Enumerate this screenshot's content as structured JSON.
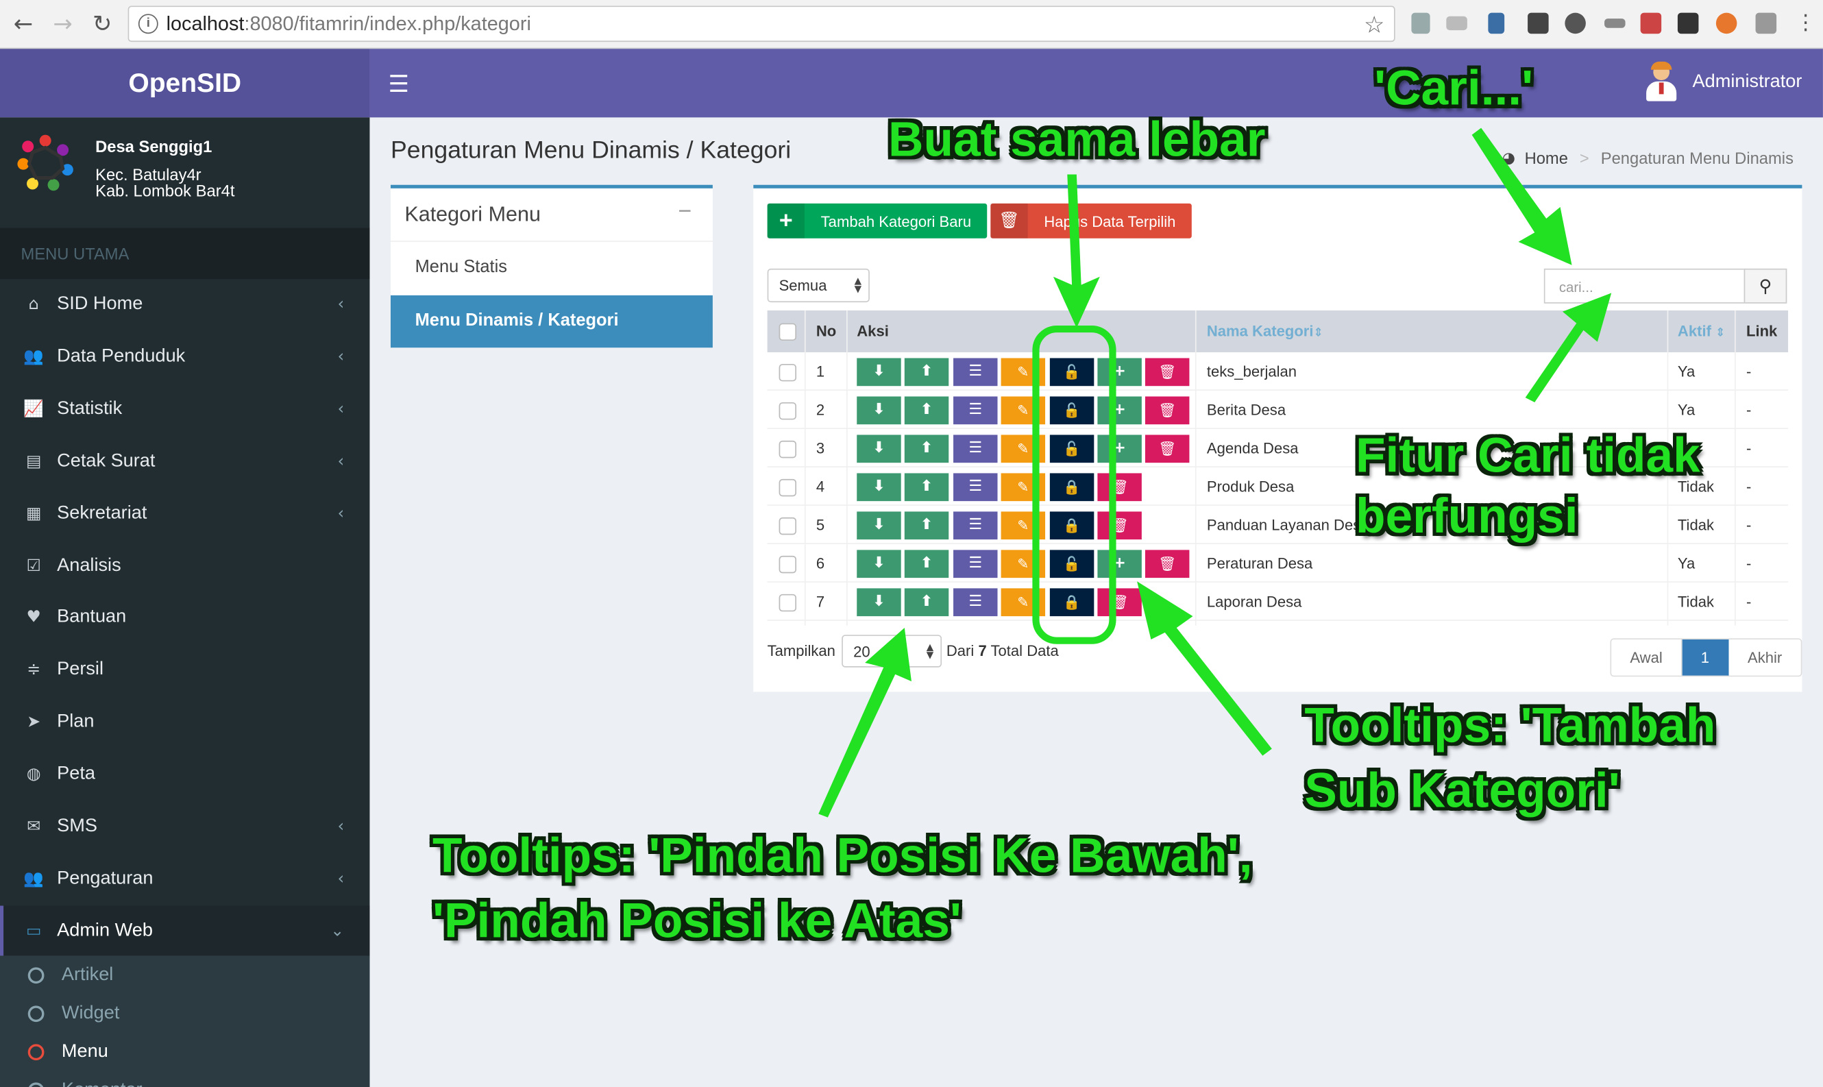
{
  "browser": {
    "url_host": "localhost",
    "url_rest": ":8080/fitamrin/index.php/kategori",
    "icons": [
      "back-icon",
      "forward-icon",
      "reload-icon",
      "info-icon",
      "star-icon"
    ]
  },
  "header": {
    "brand": "OpenSID",
    "user_name": "Administrator"
  },
  "sidebar": {
    "village": "Desa Senggig1",
    "district": "Kec. Batulay4r",
    "regency": "Kab. Lombok Bar4t",
    "menu_header": "MENU UTAMA",
    "items": [
      {
        "label": "SID Home",
        "icon": "home-icon",
        "chevron": true
      },
      {
        "label": "Data Penduduk",
        "icon": "users-icon",
        "chevron": true
      },
      {
        "label": "Statistik",
        "icon": "chart-icon",
        "chevron": true
      },
      {
        "label": "Cetak Surat",
        "icon": "print-icon",
        "chevron": true
      },
      {
        "label": "Sekretariat",
        "icon": "archive-icon",
        "chevron": true
      },
      {
        "label": "Analisis",
        "icon": "check-square-icon",
        "chevron": false
      },
      {
        "label": "Bantuan",
        "icon": "heart-icon",
        "chevron": false
      },
      {
        "label": "Persil",
        "icon": "sliders-icon",
        "chevron": false
      },
      {
        "label": "Plan",
        "icon": "location-arrow-icon",
        "chevron": false
      },
      {
        "label": "Peta",
        "icon": "globe-icon",
        "chevron": false
      },
      {
        "label": "SMS",
        "icon": "envelope-icon",
        "chevron": true
      },
      {
        "label": "Pengaturan",
        "icon": "users-icon",
        "chevron": true
      },
      {
        "label": "Admin Web",
        "icon": "desktop-icon",
        "chevron": true
      }
    ],
    "submenu": [
      {
        "label": "Artikel"
      },
      {
        "label": "Widget"
      },
      {
        "label": "Menu"
      },
      {
        "label": "Komentar"
      }
    ]
  },
  "page": {
    "title": "Pengaturan Menu Dinamis / Kategori",
    "breadcrumb_home": "Home",
    "breadcrumb_current": "Pengaturan Menu Dinamis"
  },
  "kategori_box": {
    "title": "Kategori Menu",
    "items": [
      "Menu Statis",
      "Menu Dinamis / Kategori"
    ]
  },
  "toolbar": {
    "add_label": "Tambah Kategori Baru",
    "delete_label": "Hapus Data Terpilih",
    "filter_value": "Semua",
    "search_placeholder": "cari..."
  },
  "table": {
    "headers": {
      "no": "No",
      "aksi": "Aksi",
      "nama": "Nama Kategori",
      "aktif": "Aktif",
      "link": "Link"
    },
    "rows": [
      {
        "no": "1",
        "nama": "teks_berjalan",
        "aktif": "Ya",
        "link": "-",
        "locked": false,
        "has_add": true,
        "has_del": true
      },
      {
        "no": "2",
        "nama": "Berita Desa",
        "aktif": "Ya",
        "link": "-",
        "locked": false,
        "has_add": true,
        "has_del": true
      },
      {
        "no": "3",
        "nama": "Agenda Desa",
        "aktif": "Ya",
        "link": "-",
        "locked": false,
        "has_add": true,
        "has_del": true
      },
      {
        "no": "4",
        "nama": "Produk Desa",
        "aktif": "Tidak",
        "link": "-",
        "locked": true,
        "has_add": false,
        "has_del": true
      },
      {
        "no": "5",
        "nama": "Panduan Layanan Desa",
        "aktif": "Tidak",
        "link": "-",
        "locked": true,
        "has_add": false,
        "has_del": true
      },
      {
        "no": "6",
        "nama": "Peraturan Desa",
        "aktif": "Ya",
        "link": "-",
        "locked": false,
        "has_add": true,
        "has_del": true
      },
      {
        "no": "7",
        "nama": "Laporan Desa",
        "aktif": "Tidak",
        "link": "-",
        "locked": true,
        "has_add": false,
        "has_del": true
      }
    ]
  },
  "footer": {
    "show_label": "Tampilkan",
    "page_size": "20",
    "from_label": "Dari",
    "total": "7",
    "total_label": "Total Data",
    "pages": [
      "Awal",
      "1",
      "Akhir"
    ]
  },
  "annotations": {
    "cari": "'Cari...'",
    "same_width": "Buat sama lebar",
    "search_broken_1": "Fitur Cari tidak",
    "search_broken_2": "berfungsi",
    "tooltip_add_1": "Tooltips: 'Tambah",
    "tooltip_add_2": "Sub Kategori'",
    "tooltip_move_1": "Tooltips: 'Pindah Posisi Ke Bawah',",
    "tooltip_move_2": "'Pindah Posisi ke Atas'"
  },
  "colors": {
    "brand": "#605ca8",
    "sidebar": "#222d32",
    "primary": "#3c8dbc",
    "olive": "#3d9970",
    "annotation": "#22e022"
  }
}
